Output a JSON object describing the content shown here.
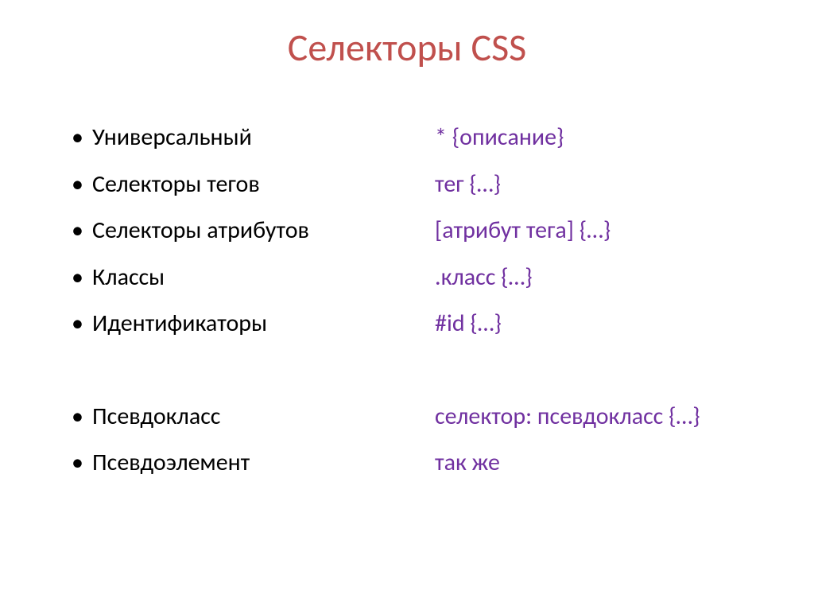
{
  "title": "Селекторы CSS",
  "left": {
    "items": [
      "Универсальный",
      "Селекторы тегов",
      "Селекторы атрибутов",
      "Классы",
      "Идентификаторы"
    ],
    "items2": [
      "Псевдокласс",
      "Псевдоэлемент"
    ]
  },
  "right": {
    "lines": [
      "* {описание}",
      "тег {…}",
      "[атрибут тега] {…}",
      ".класс {…}",
      "#id {…}"
    ],
    "lines2": [
      "селектор: псевдокласс {…}",
      "так же"
    ]
  }
}
